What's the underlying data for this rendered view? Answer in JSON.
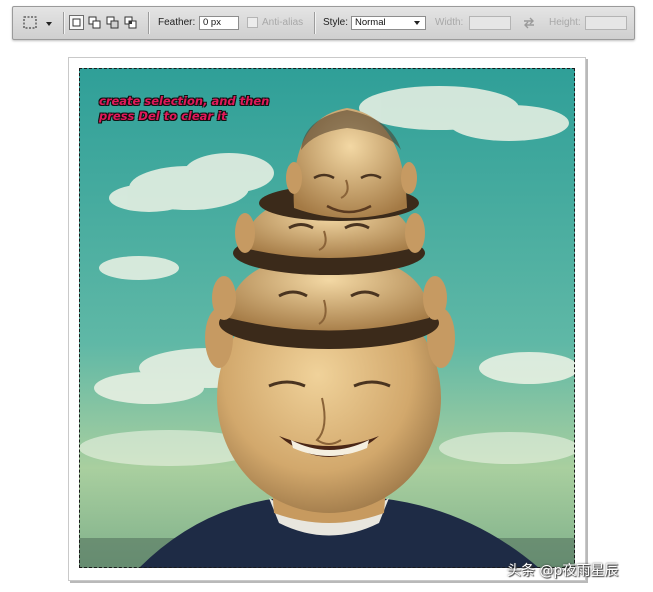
{
  "options_bar": {
    "feather_label": "Feather:",
    "feather_value": "0 px",
    "antialias_label": "Anti-alias",
    "antialias_checked": false,
    "style_label": "Style:",
    "style_value": "Normal",
    "width_label": "Width:",
    "width_value": "",
    "height_label": "Height:",
    "height_value": "",
    "selection_modes": [
      "new-selection",
      "add-to-selection",
      "subtract-from-selection",
      "intersect-with-selection"
    ],
    "active_mode": "new-selection"
  },
  "canvas": {
    "hint_lines": [
      "create selection, and then",
      "press Del to clear it"
    ],
    "hint_color": "#e0195a",
    "sky_color": "#3aa79b",
    "skin_color": "#d9b37c"
  },
  "watermark": "头条 @p夜雨星辰"
}
